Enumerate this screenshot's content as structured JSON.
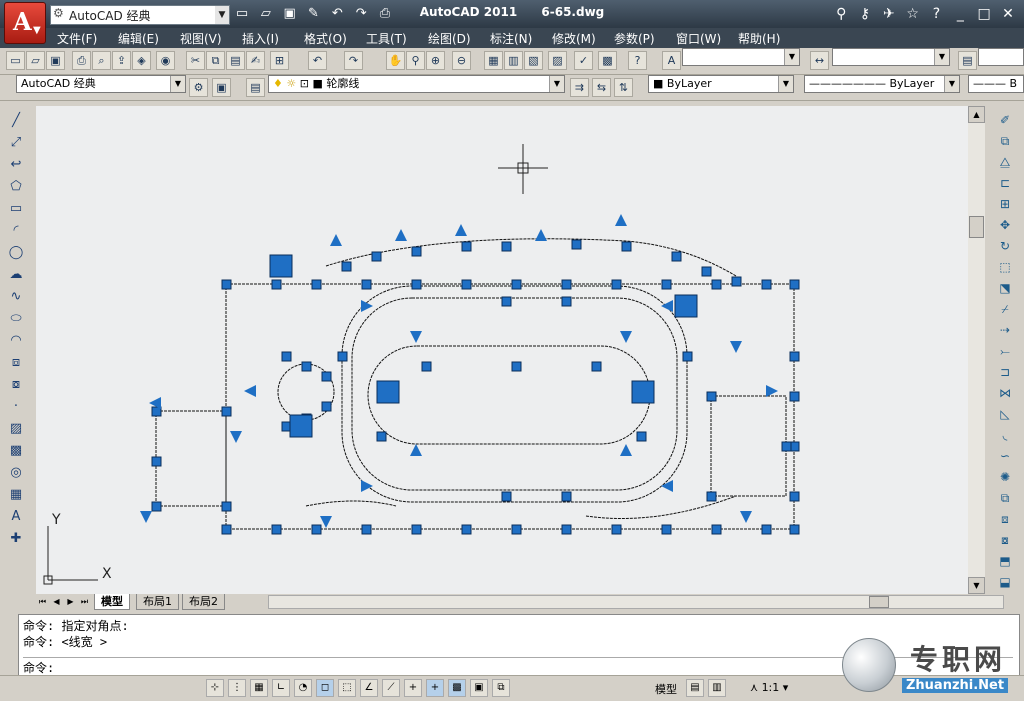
{
  "app": {
    "workspace": "AutoCAD 经典",
    "name": "AutoCAD 2011",
    "file": "6-65.dwg"
  },
  "menu": [
    "文件(F)",
    "编辑(E)",
    "视图(V)",
    "插入(I)",
    "格式(O)",
    "工具(T)",
    "绘图(D)",
    "标注(N)",
    "修改(M)",
    "参数(P)",
    "窗口(W)",
    "帮助(H)"
  ],
  "toolbar2": {
    "workspace_combo": "AutoCAD 经典",
    "layer_combo": "轮廓线",
    "color_combo": "ByLayer",
    "linetype_combo": "ByLayer",
    "lineweight_combo": "B"
  },
  "ucs": {
    "x": "X",
    "y": "Y"
  },
  "tabs": [
    "模型",
    "布局1",
    "布局2"
  ],
  "command_lines": [
    "命令: 指定对角点:",
    "命令:  <线宽 >"
  ],
  "command_prompt": "命令:",
  "status": {
    "model": "模型",
    "scale": "1:1"
  },
  "watermark": {
    "chinese": "专职网",
    "site": "Zhuanzhi.Net"
  },
  "colors": {
    "grip": "#1f6fc4",
    "titlebar": "#3a4652",
    "canvas": "#edeeef"
  }
}
